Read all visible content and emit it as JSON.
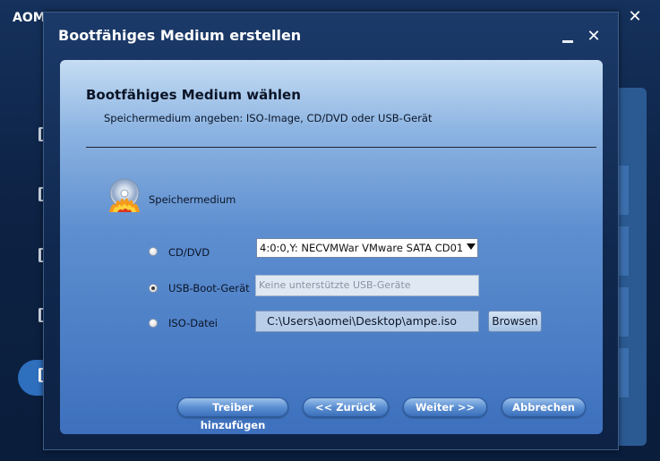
{
  "background": {
    "app_title": "AOM",
    "close_symbol": "✕"
  },
  "dialog": {
    "title": "Bootfähiges Medium erstellen",
    "close_symbol": "✕"
  },
  "panel": {
    "heading": "Bootfähiges Medium wählen",
    "subtitle": "Speichermedium angeben: ISO-Image, CD/DVD oder USB-Gerät",
    "storage_label": "Speichermedium"
  },
  "options": {
    "cddvd": {
      "label": "CD/DVD",
      "selected": false,
      "value": "4:0:0,Y: NECVMWar VMware SATA CD01"
    },
    "usb": {
      "label": "USB-Boot-Gerät",
      "selected": true,
      "placeholder": "Keine unterstützte USB-Geräte"
    },
    "iso": {
      "label": "ISO-Datei",
      "selected": false,
      "value": "C:\\Users\\aomei\\Desktop\\ampe.iso",
      "browse_label": "Browsen"
    }
  },
  "buttons": {
    "add_driver": "Treiber hinzufügen",
    "back": "<< Zurück",
    "next": "Weiter >>",
    "cancel": "Abbrechen"
  },
  "colors": {
    "accent": "#3b6fba",
    "window_bg": "#10284e",
    "panel_top": "#c6ddf3",
    "panel_bottom": "#3d70bd"
  }
}
